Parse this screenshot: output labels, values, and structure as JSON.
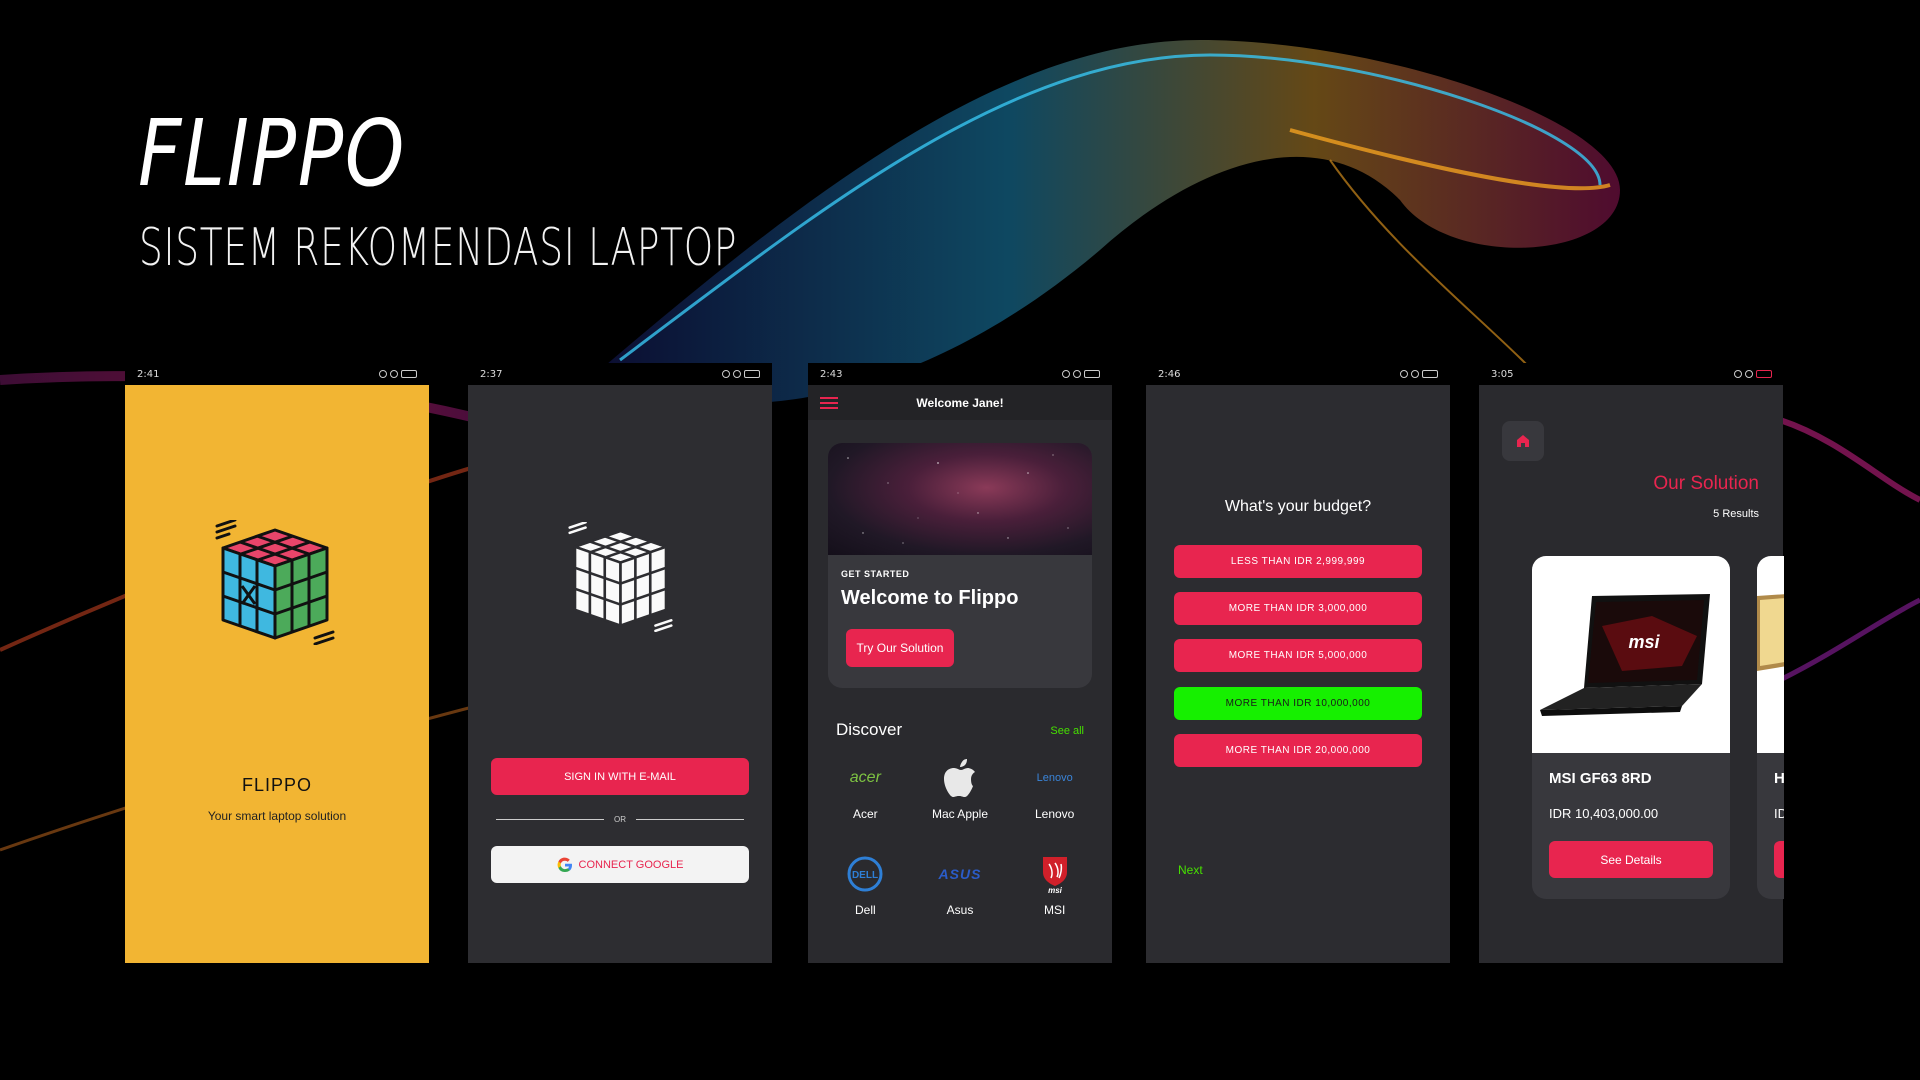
{
  "hero": {
    "title": "FLIPPO",
    "subtitle": "SISTEM REKOMENDASI LAPTOP"
  },
  "colors": {
    "accent": "#e8254f",
    "selected": "#16f000",
    "link_green": "#46e000",
    "splash_bg": "#f2b533",
    "dark_bg": "#2c2c30"
  },
  "phones": [
    {
      "status_time": "2:41",
      "app_name": "FLIPPO",
      "tagline": "Your smart laptop solution",
      "logo_icon": "rubiks-cube-icon"
    },
    {
      "status_time": "2:37",
      "signin_label": "SIGN IN WITH E-MAIL",
      "or_label": "OR",
      "google_label": "CONNECT GOOGLE",
      "google_icon": "google-icon"
    },
    {
      "status_time": "2:43",
      "header_title": "Welcome Jane!",
      "card_kicker": "GET STARTED",
      "card_title": "Welcome to Flippo",
      "card_button": "Try Our Solution",
      "discover_title": "Discover",
      "see_all": "See all",
      "brands": [
        {
          "label": "Acer",
          "logo": "acer"
        },
        {
          "label": "Mac Apple",
          "icon": "apple-icon"
        },
        {
          "label": "Lenovo",
          "logo": "Lenovo"
        },
        {
          "label": "Dell",
          "logo": "DELL"
        },
        {
          "label": "Asus",
          "logo": "ASUS"
        },
        {
          "label": "MSI",
          "logo": "msi"
        }
      ]
    },
    {
      "status_time": "2:46",
      "question": "What's your budget?",
      "options": [
        "LESS THAN IDR 2,999,999",
        "MORE THAN IDR 3,000,000",
        "MORE THAN IDR 5,000,000",
        "MORE THAN IDR 10,000,000",
        "MORE THAN IDR 20,000,000"
      ],
      "selected_index": 3,
      "next_label": "Next"
    },
    {
      "status_time": "3:05",
      "title": "Our Solution",
      "results": "5 Results",
      "products": [
        {
          "name": "MSI GF63 8RD",
          "price": "IDR 10,403,000.00",
          "button": "See Details",
          "brand_mark": "msi"
        },
        {
          "name": "H",
          "price": "ID"
        }
      ]
    }
  ]
}
